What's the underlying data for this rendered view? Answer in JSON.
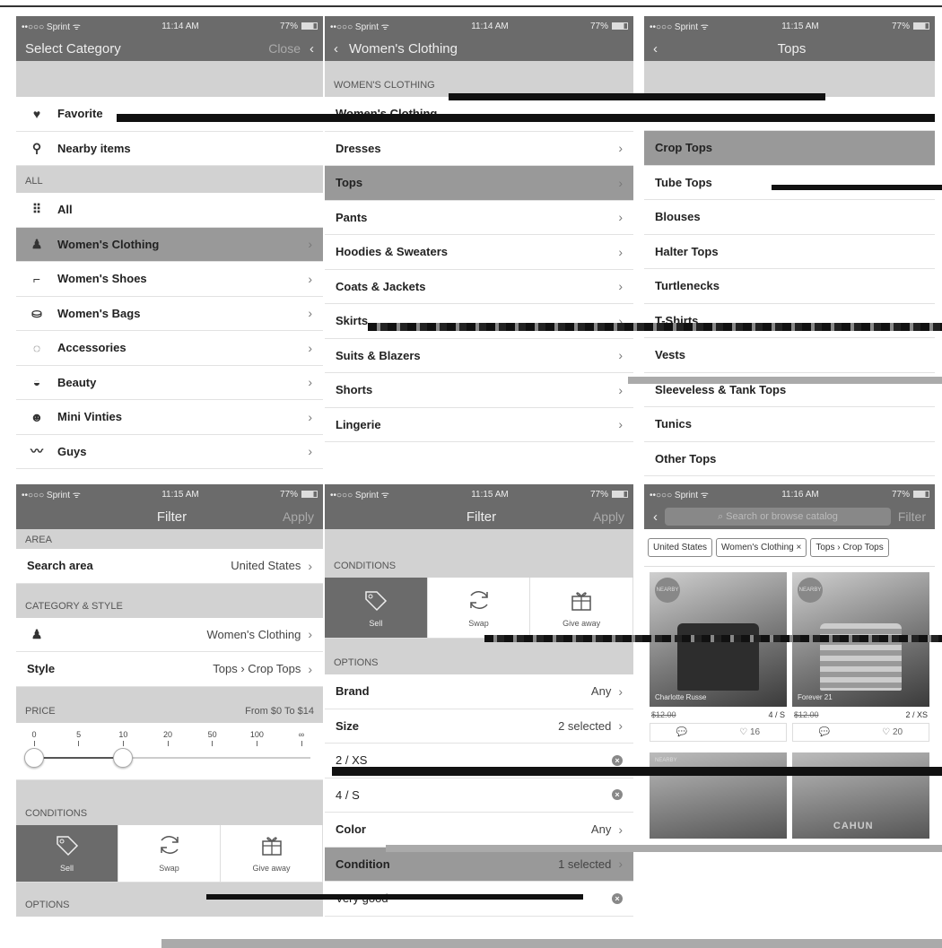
{
  "status": {
    "carrier": "••○○○ Sprint ᯤ",
    "battery": "77%",
    "times": [
      "11:14 AM",
      "11:14 AM",
      "11:15 AM",
      "11:15 AM",
      "11:15 AM",
      "11:16 AM"
    ]
  },
  "p1": {
    "title": "Select Category",
    "close": "Close",
    "top_items": [
      {
        "label": "Favorite",
        "icon": "heart-icon",
        "glyph": "♥"
      },
      {
        "label": "Nearby items",
        "icon": "location-pin-icon",
        "glyph": "⚲"
      }
    ],
    "section_all": "ALL",
    "items": [
      {
        "label": "All",
        "icon": "grid-icon",
        "glyph": "⠿",
        "chev": false
      },
      {
        "label": "Women's Clothing",
        "icon": "dress-icon",
        "glyph": "♟",
        "chev": true
      },
      {
        "label": "Women's Shoes",
        "icon": "shoe-icon",
        "glyph": "⌐",
        "chev": true
      },
      {
        "label": "Women's Bags",
        "icon": "bag-icon",
        "glyph": "⛀",
        "chev": true
      },
      {
        "label": "Accessories",
        "icon": "watch-icon",
        "glyph": "◌",
        "chev": true
      },
      {
        "label": "Beauty",
        "icon": "lips-icon",
        "glyph": "◒",
        "chev": true
      },
      {
        "label": "Mini Vinties",
        "icon": "baby-icon",
        "glyph": "☻",
        "chev": true
      },
      {
        "label": "Guys",
        "icon": "mustache-icon",
        "glyph": "〰",
        "chev": true
      }
    ]
  },
  "p2": {
    "title": "Women's Clothing",
    "section": "WOMEN'S CLOTHING",
    "items": [
      "Women's Clothing",
      "Dresses",
      "Tops",
      "Pants",
      "Hoodies & Sweaters",
      "Coats & Jackets",
      "Skirts",
      "Suits & Blazers",
      "Shorts",
      "Lingerie"
    ]
  },
  "p3": {
    "title": "Tops",
    "items": [
      "Crop Tops",
      "Tube Tops",
      "Blouses",
      "Halter Tops",
      "Turtlenecks",
      "T-Shirts",
      "Vests",
      "Sleeveless & Tank Tops",
      "Tunics",
      "Other Tops"
    ]
  },
  "p4": {
    "title": "Filter",
    "apply": "Apply",
    "area_header": "AREA",
    "search_area_label": "Search area",
    "search_area_value": "United States",
    "cat_header": "CATEGORY & STYLE",
    "category_value": "Women's Clothing",
    "style_label": "Style",
    "style_value": "Tops › Crop Tops",
    "price_header": "PRICE",
    "price_value": "From $0 To $14",
    "ticks": [
      "0",
      "5",
      "10",
      "20",
      "50",
      "100",
      "∞"
    ],
    "price_range": {
      "min_tick_index": 0,
      "max_tick_index": 2
    },
    "conditions_header": "CONDITIONS",
    "conditions": [
      "Sell",
      "Swap",
      "Give away"
    ],
    "options_header": "OPTIONS"
  },
  "p5": {
    "title": "Filter",
    "apply": "Apply",
    "conditions_header": "CONDITIONS",
    "conditions": [
      "Sell",
      "Swap",
      "Give away"
    ],
    "options_header": "OPTIONS",
    "rows": [
      {
        "label": "Brand",
        "value": "Any"
      },
      {
        "label": "Size",
        "value": "2 selected"
      },
      {
        "label": "2 / XS",
        "value": ""
      },
      {
        "label": "4 / S",
        "value": ""
      },
      {
        "label": "Color",
        "value": "Any"
      },
      {
        "label": "Condition",
        "value": "1 selected"
      },
      {
        "label": "Very good",
        "value": ""
      }
    ]
  },
  "p6": {
    "search_placeholder": "Search or browse catalog",
    "filter": "Filter",
    "chips": [
      "United States",
      "Women's Clothing ×",
      "Tops › Crop Tops"
    ],
    "cards": [
      {
        "brand": "Charlotte Russe",
        "price": "$12.00",
        "size": "4 / S",
        "likes": "16"
      },
      {
        "brand": "Forever 21",
        "price": "$12.00",
        "size": "2 / XS",
        "likes": "20"
      }
    ],
    "badge": "NEARBY",
    "shirt_text": "CAHUN"
  }
}
